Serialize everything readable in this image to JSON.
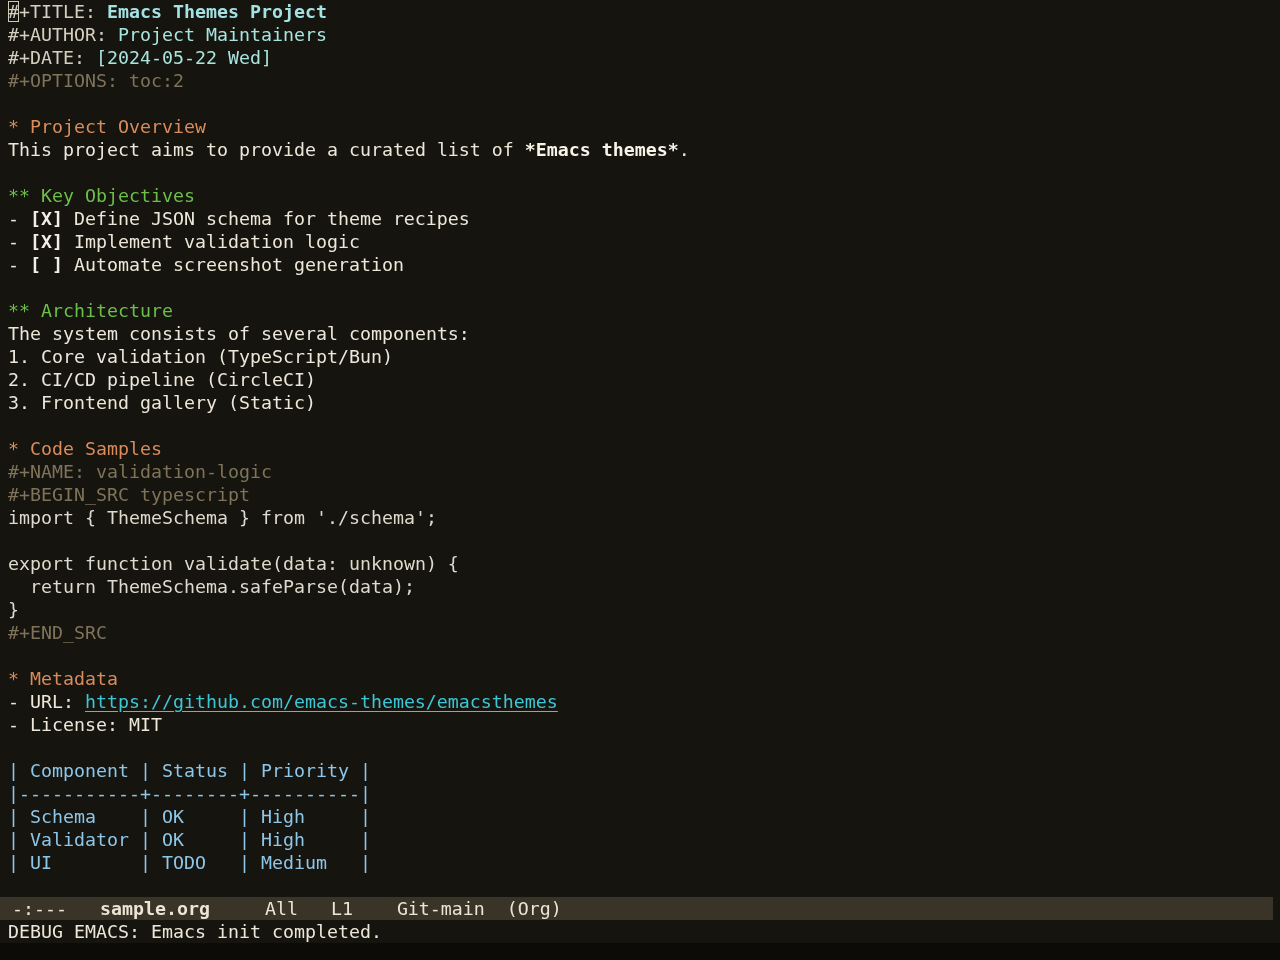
{
  "buffer": {
    "header": [
      {
        "kind": "title",
        "keyword": "#+TITLE:",
        "value": "Emacs Themes Project",
        "cursor": true
      },
      {
        "kind": "info",
        "keyword": "#+AUTHOR:",
        "value": "Project Maintainers",
        "cursor": false
      },
      {
        "kind": "info",
        "keyword": "#+DATE:",
        "value": "[2024-05-22 Wed]",
        "cursor": false
      },
      {
        "kind": "meta",
        "keyword": "#+OPTIONS:",
        "value": "toc:2",
        "cursor": false
      }
    ],
    "lines": [
      {
        "kind": "blank"
      },
      {
        "kind": "heading",
        "text": "* Project Overview"
      },
      {
        "kind": "paragraph",
        "segments": [
          {
            "text": "This project aims to provide a curated list of ",
            "bold": false
          },
          {
            "text": "*Emacs themes*",
            "bold": true
          },
          {
            "text": ".",
            "bold": false
          }
        ]
      },
      {
        "kind": "blank"
      },
      {
        "kind": "subheading",
        "text": "** Key Objectives"
      },
      {
        "kind": "checkbox-item",
        "bullet": "-",
        "checkbox": "[X]",
        "text": "Define JSON schema for theme recipes"
      },
      {
        "kind": "checkbox-item",
        "bullet": "-",
        "checkbox": "[X]",
        "text": "Implement validation logic"
      },
      {
        "kind": "checkbox-item",
        "bullet": "-",
        "checkbox": "[ ]",
        "text": "Automate screenshot generation"
      },
      {
        "kind": "blank"
      },
      {
        "kind": "subheading",
        "text": "** Architecture"
      },
      {
        "kind": "text",
        "text": "The system consists of several components:"
      },
      {
        "kind": "text",
        "text": "1. Core validation (TypeScript/Bun)"
      },
      {
        "kind": "text",
        "text": "2. CI/CD pipeline (CircleCI)"
      },
      {
        "kind": "text",
        "text": "3. Frontend gallery (Static)"
      },
      {
        "kind": "blank"
      },
      {
        "kind": "heading",
        "text": "* Code Samples"
      },
      {
        "kind": "meta",
        "text": "#+NAME: validation-logic"
      },
      {
        "kind": "meta",
        "text": "#+BEGIN_SRC typescript"
      },
      {
        "kind": "code",
        "text": "import { ThemeSchema } from './schema';"
      },
      {
        "kind": "blank"
      },
      {
        "kind": "code",
        "text": "export function validate(data: unknown) {"
      },
      {
        "kind": "code",
        "text": "  return ThemeSchema.safeParse(data);"
      },
      {
        "kind": "code",
        "text": "}"
      },
      {
        "kind": "meta",
        "text": "#+END_SRC"
      },
      {
        "kind": "blank"
      },
      {
        "kind": "heading",
        "text": "* Metadata"
      },
      {
        "kind": "link-item",
        "label": "- URL:",
        "link": "https://github.com/emacs-themes/emacsthemes"
      },
      {
        "kind": "text",
        "text": "- License: MIT"
      },
      {
        "kind": "blank"
      },
      {
        "kind": "table",
        "text": "| Component | Status | Priority |"
      },
      {
        "kind": "table",
        "text": "|-----------+--------+----------|"
      },
      {
        "kind": "table",
        "text": "| Schema    | OK     | High     |"
      },
      {
        "kind": "table",
        "text": "| Validator | OK     | High     |"
      },
      {
        "kind": "table",
        "text": "| UI        | TODO   | Medium   |"
      }
    ]
  },
  "mode_line": {
    "status": "-:---",
    "buffer_name": "sample.org",
    "position": "All",
    "line": "L1",
    "vc": "Git-main",
    "mode": "(Org)"
  },
  "echo_area": {
    "message": "DEBUG EMACS: Emacs init completed."
  }
}
